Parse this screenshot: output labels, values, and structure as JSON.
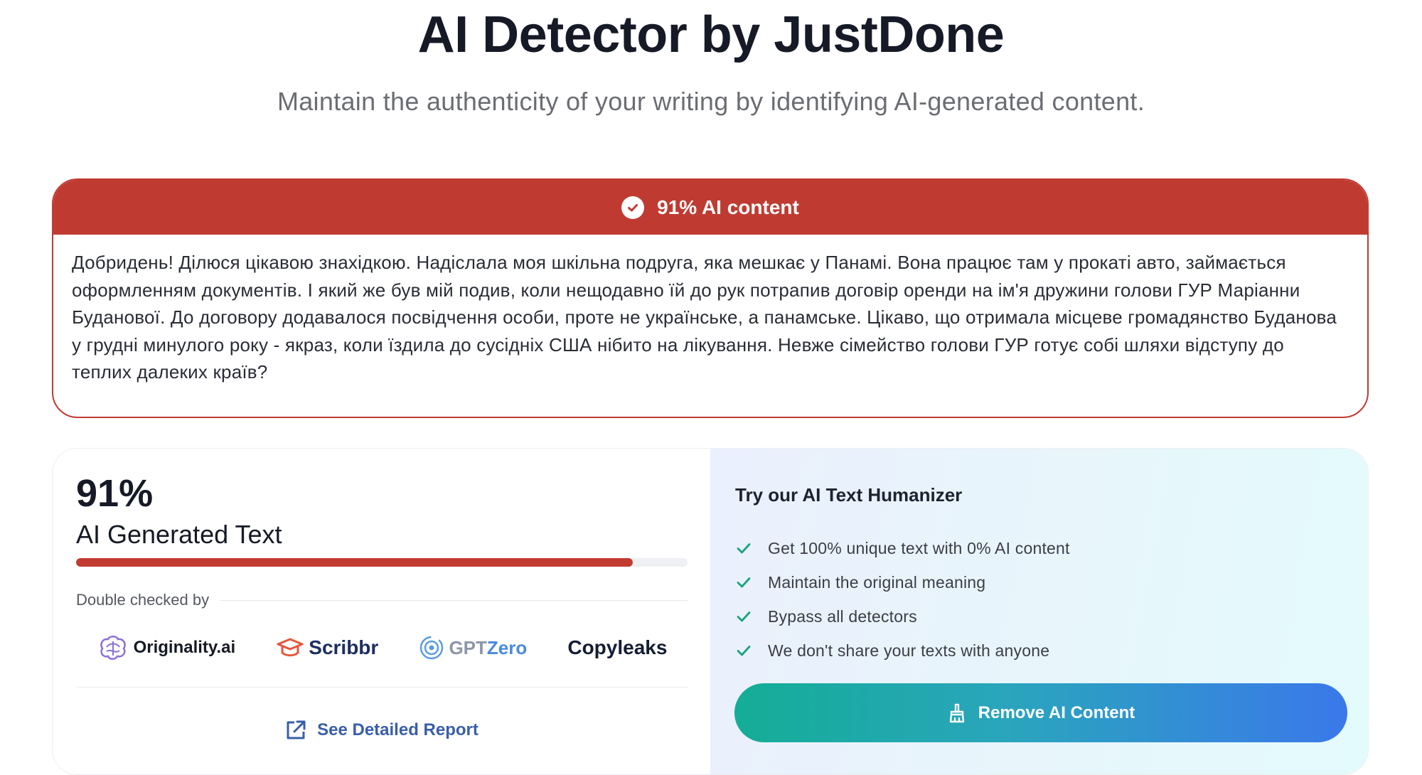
{
  "page": {
    "title": "AI Detector by JustDone",
    "subtitle": "Maintain the authenticity of your writing by identifying AI-generated content."
  },
  "result": {
    "header_label": "91% AI content",
    "analyzed_text": "Добридень! Ділюся цікавою знахідкою. Надіслала моя шкільна подруга, яка мешкає у Панамі. Вона працює там у прокаті авто, займається оформленням документів. І який же був мій подив, коли нещодавно їй до рук потрапив договір оренди на ім'я дружини голови ГУР Маріанни Буданової. До договору додавалося посвідчення особи, проте не українське, а панамське. Цікаво, що отримала місцеве громадянство Буданова у грудні минулого року - якраз, коли їздила до сусідніх США нібито на лікування. Невже сімейство голови ГУР готує собі шляхи відступу до теплих далеких країв?",
    "accent_color": "#bf3b32"
  },
  "score": {
    "percent_label": "91%",
    "label": "AI Generated Text",
    "ai_fraction": 0.91,
    "double_checked_label": "Double checked by",
    "detectors": [
      {
        "name": "Originality.ai"
      },
      {
        "name": "Scribbr"
      },
      {
        "name_prefix": "GPT",
        "name_suffix": "Zero"
      },
      {
        "name": "Copyleaks"
      }
    ],
    "report_link": "See Detailed Report"
  },
  "humanizer": {
    "title": "Try our AI Text Humanizer",
    "features": [
      "Get 100% unique text with 0% AI content",
      "Maintain the original meaning",
      "Bypass all detectors",
      "We don't share your texts with anyone"
    ],
    "button_label": "Remove AI Content",
    "check_color": "#1aa37a"
  }
}
